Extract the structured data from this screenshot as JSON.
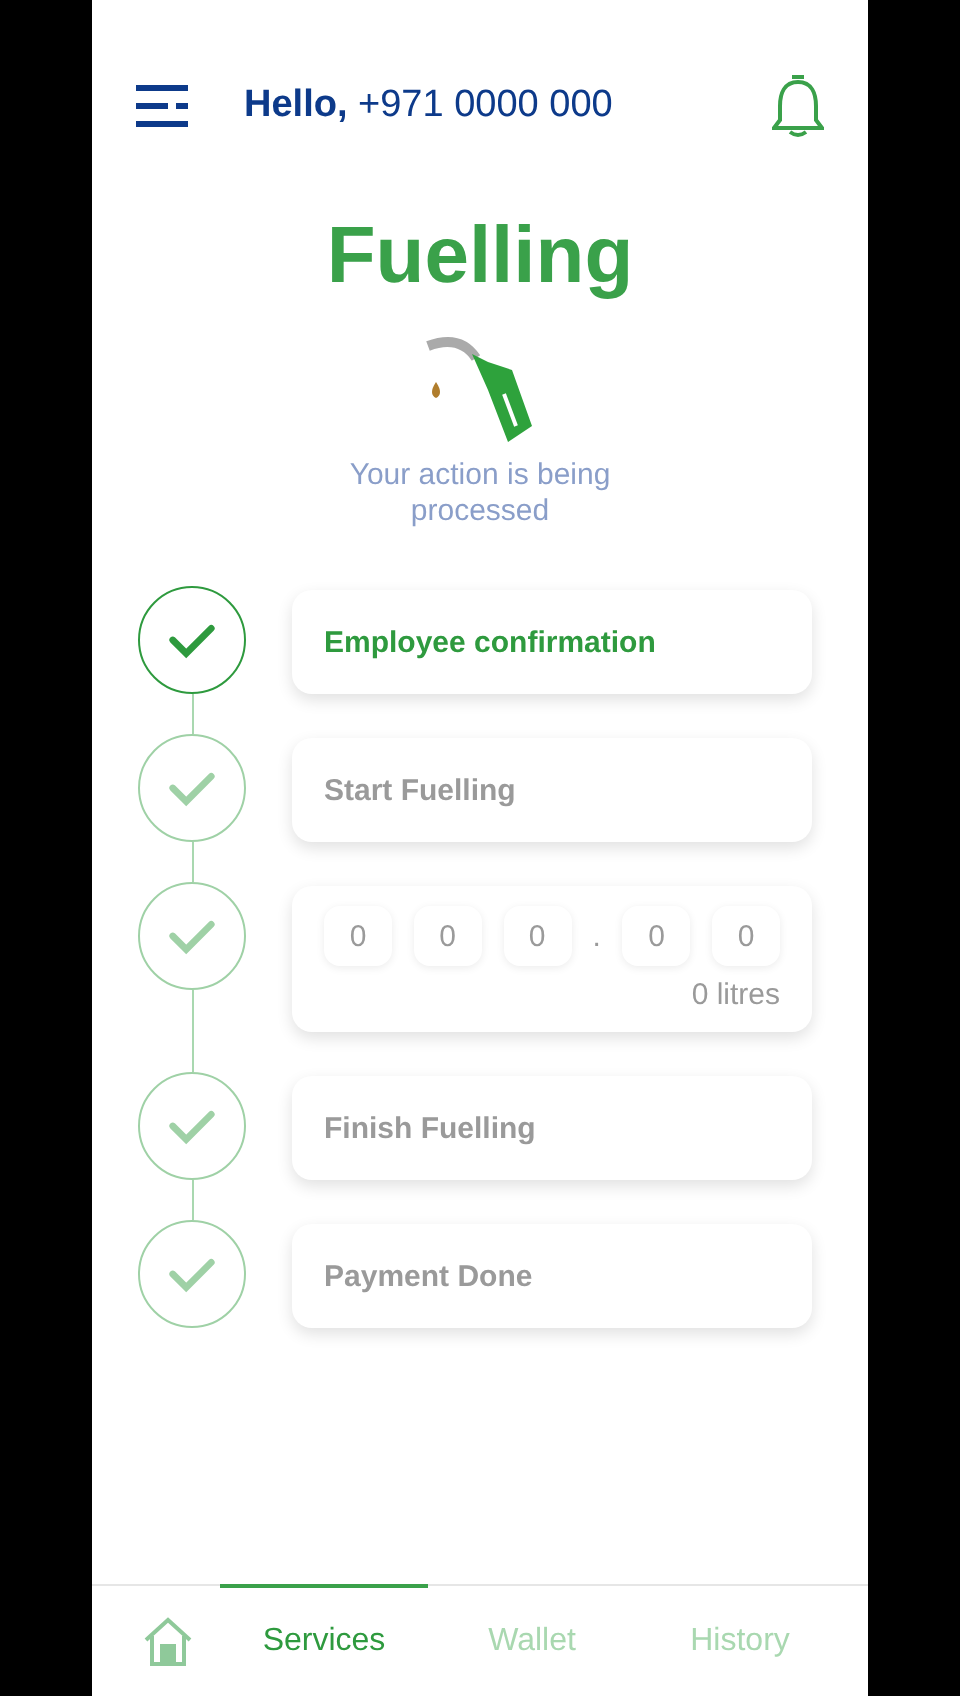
{
  "header": {
    "greeting": "**Hello,** +971 0000 000"
  },
  "title": "Fuelling",
  "status": "Your action is being processed",
  "steps": [
    {
      "kind": "label",
      "label": "Employee confirmation",
      "active": true
    },
    {
      "kind": "label",
      "label": "Start Fuelling",
      "active": false
    },
    {
      "kind": "meter",
      "digits": [
        "0",
        "0",
        "0",
        ".",
        "0",
        "0"
      ],
      "reading": "0 litres",
      "active": false
    },
    {
      "kind": "label",
      "label": "Finish Fuelling",
      "active": false
    },
    {
      "kind": "label",
      "label": "Payment Done",
      "active": false
    }
  ],
  "nav": [
    {
      "kind": "icon",
      "selected": false
    },
    {
      "kind": "text",
      "label": "Services",
      "selected": true
    },
    {
      "kind": "text",
      "label": "Wallet",
      "selected": false
    },
    {
      "kind": "text",
      "label": "History",
      "selected": false
    }
  ]
}
